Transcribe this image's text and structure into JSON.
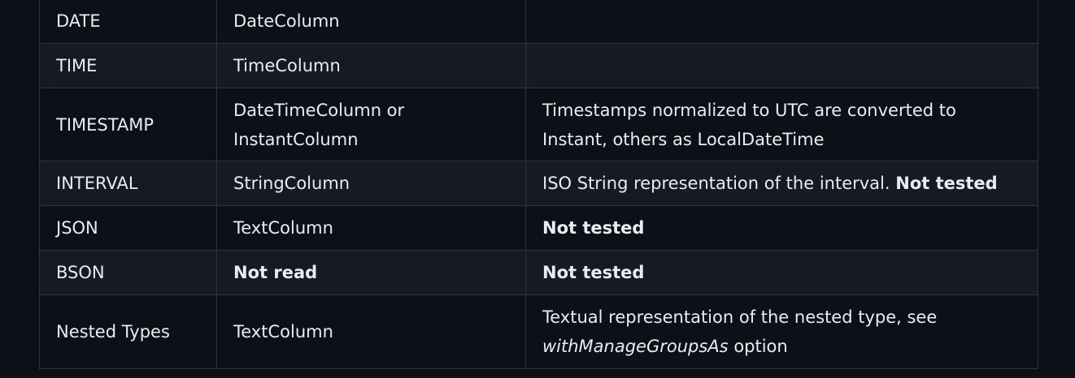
{
  "rows": [
    {
      "type": "DATE",
      "column": "DateColumn",
      "note": ""
    },
    {
      "type": "TIME",
      "column": "TimeColumn",
      "note": ""
    },
    {
      "type": "TIMESTAMP",
      "column": "DateTimeColumn or InstantColumn",
      "note": "Timestamps normalized to UTC are converted to Instant, others as LocalDateTime"
    },
    {
      "type": "INTERVAL",
      "column": "StringColumn",
      "note": "ISO String representation of the interval.",
      "note_bold": "Not tested"
    },
    {
      "type": "JSON",
      "column": "TextColumn",
      "note_bold": "Not tested"
    },
    {
      "type": "BSON",
      "column_bold": "Not read",
      "note_bold": "Not tested"
    },
    {
      "type": "Nested Types",
      "column": "TextColumn",
      "note": "Textual representation of the nested type, see",
      "note_italic": "withManageGroupsAs",
      "note_suffix": "option"
    }
  ]
}
